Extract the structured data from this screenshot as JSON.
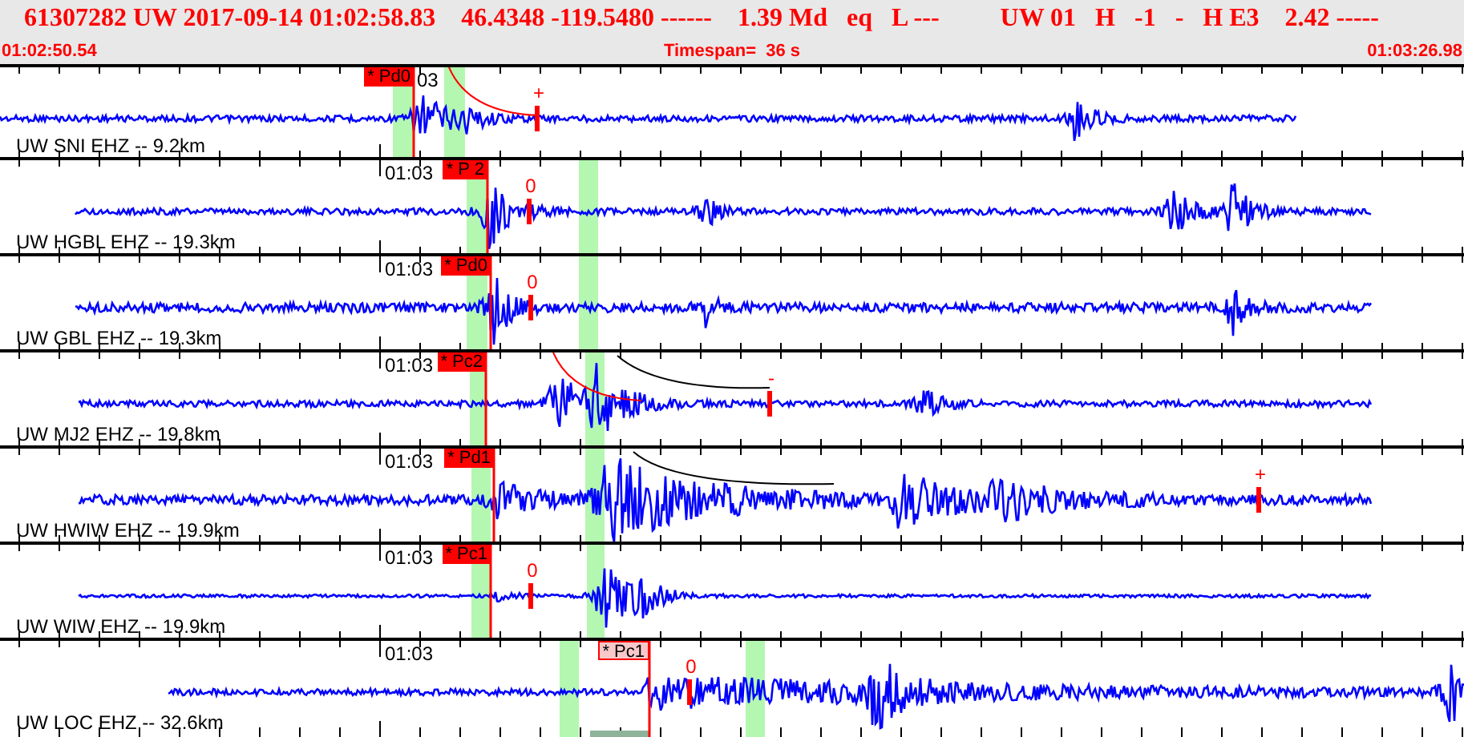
{
  "header": {
    "event_fields": [
      "61307282 UW 2017-09-14 01:02:58.83",
      "46.4348 -119.5480 ------",
      "1.39 Md",
      "eq",
      "L ---",
      "UW 01",
      "H",
      "-1",
      "-",
      "H E3",
      "2.42 -----"
    ],
    "start_time": "01:02:50.54",
    "timespan": "Timespan=  36 s",
    "end_time": "01:03:26.98"
  },
  "traces": [
    {
      "station": "UW SNI EHZ -- 9.2km",
      "time_label": "03",
      "pick": {
        "label": "* Pd0",
        "selected": true
      },
      "amp_mark": "+"
    },
    {
      "station": "UW HGBL EHZ -- 19.3km",
      "time_label": "01:03",
      "pick": {
        "label": "* P 2",
        "selected": true
      },
      "amp_mark": "0"
    },
    {
      "station": "UW GBL EHZ -- 19.3km",
      "time_label": "01:03",
      "pick": {
        "label": "* Pd0",
        "selected": true
      },
      "amp_mark": "0"
    },
    {
      "station": "UW MJ2 EHZ -- 19.8km",
      "time_label": "01:03",
      "pick": {
        "label": "* Pc2",
        "selected": true
      },
      "amp_mark": "-"
    },
    {
      "station": "UW HWIW EHZ -- 19.9km",
      "time_label": "01:03",
      "pick": {
        "label": "* Pd1",
        "selected": true
      },
      "amp_mark": "+"
    },
    {
      "station": "UW WIW EHZ -- 19.9km",
      "time_label": "01:03",
      "pick": {
        "label": "* Pc1",
        "selected": true
      },
      "amp_mark": "0"
    },
    {
      "station": "UW LOC EHZ -- 32.6km",
      "time_label": "01:03",
      "pick": {
        "label": "* Pc1",
        "selected": false
      },
      "amp_mark": "0"
    }
  ]
}
